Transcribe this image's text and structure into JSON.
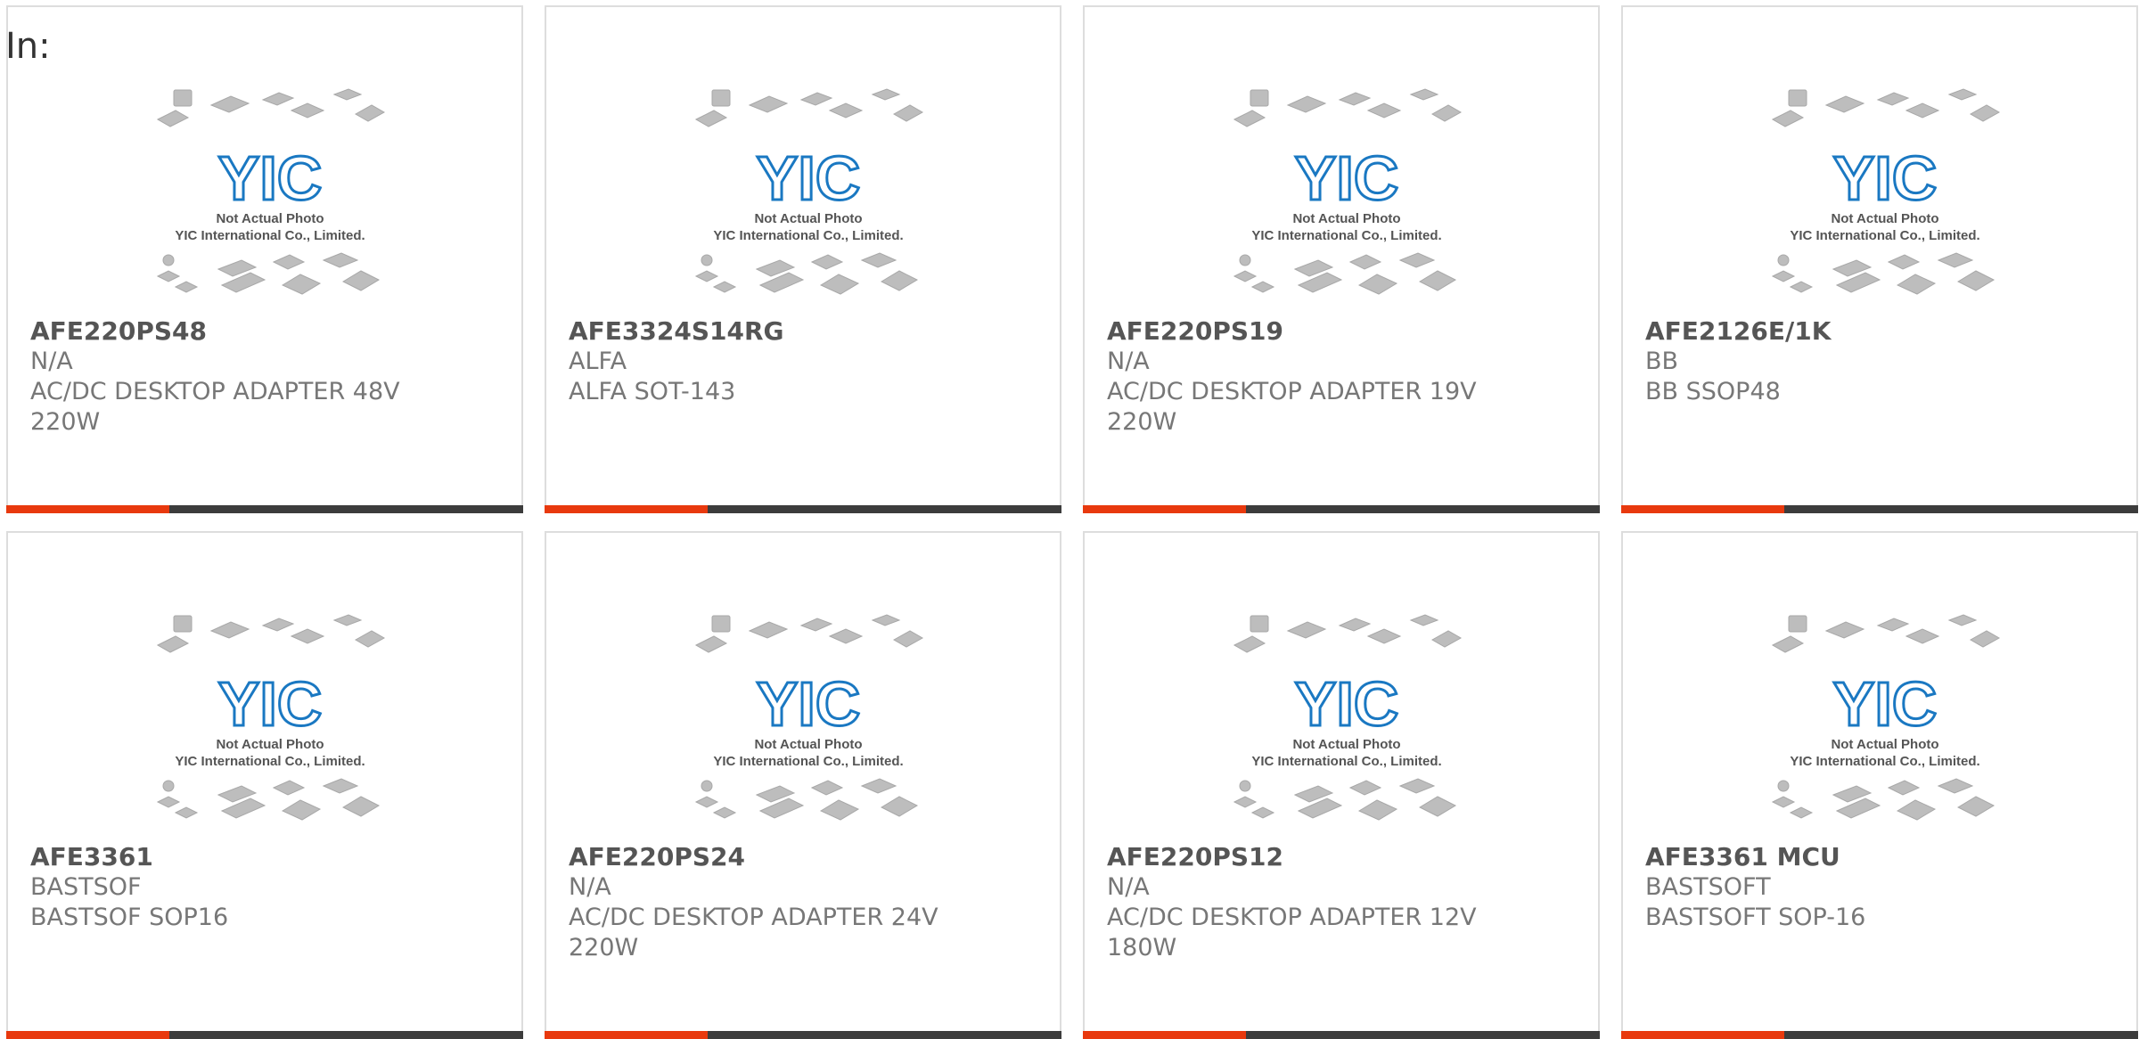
{
  "header": {
    "in_label": "In:"
  },
  "thumbnail": {
    "line1": "Not Actual Photo",
    "line2": "YIC International Co., Limited.",
    "logo_text": "YIC",
    "logo_color": "#1a78c2",
    "chip_color": "#bdbdbd"
  },
  "colors": {
    "accent": "#e8390e",
    "bar_dark": "#3c3c3c",
    "text": "#666666"
  },
  "products": [
    {
      "part": "AFE220PS48",
      "manufacturer": "N/A",
      "description": "AC/DC DESKTOP ADAPTER 48V 220W"
    },
    {
      "part": "AFE3324S14RG",
      "manufacturer": "ALFA",
      "description": "ALFA SOT-143"
    },
    {
      "part": "AFE220PS19",
      "manufacturer": "N/A",
      "description": "AC/DC DESKTOP ADAPTER 19V 220W"
    },
    {
      "part": "AFE2126E/1K",
      "manufacturer": "BB",
      "description": "BB SSOP48"
    },
    {
      "part": "AFE3361",
      "manufacturer": "BASTSOF",
      "description": "BASTSOF SOP16"
    },
    {
      "part": "AFE220PS24",
      "manufacturer": "N/A",
      "description": "AC/DC DESKTOP ADAPTER 24V 220W"
    },
    {
      "part": "AFE220PS12",
      "manufacturer": "N/A",
      "description": "AC/DC DESKTOP ADAPTER 12V 180W"
    },
    {
      "part": "AFE3361 MCU",
      "manufacturer": "BASTSOFT",
      "description": "BASTSOFT SOP-16"
    }
  ]
}
